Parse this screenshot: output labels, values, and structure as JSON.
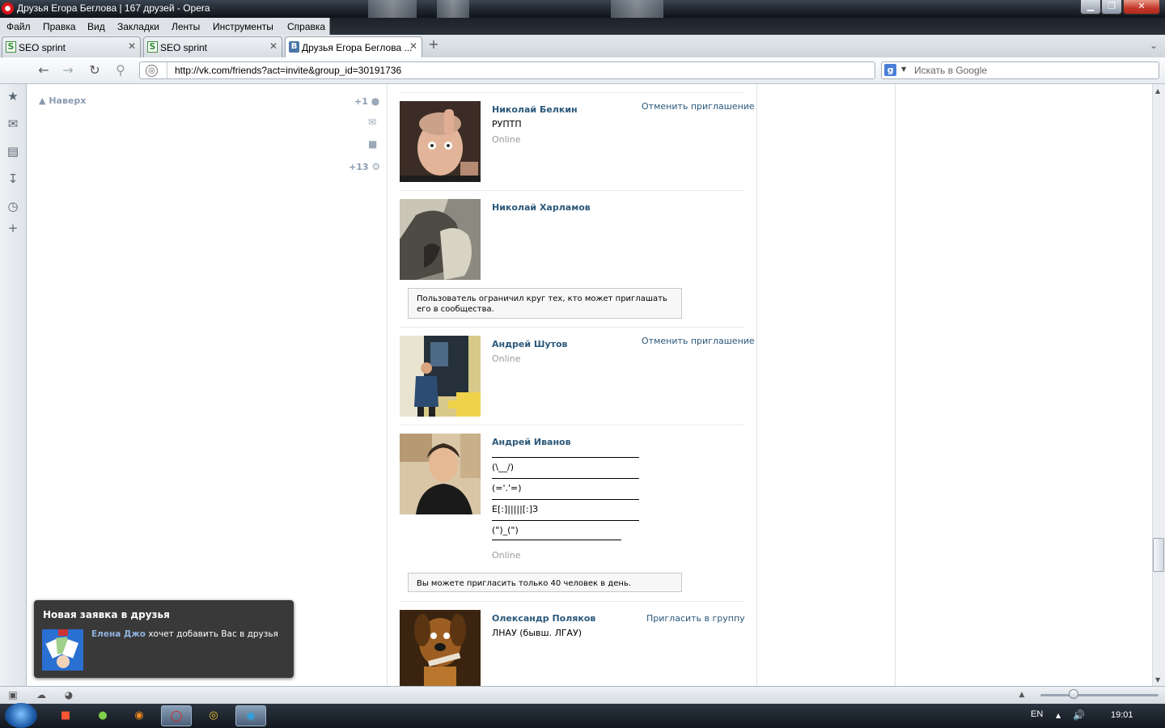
{
  "window": {
    "title": "Друзья Егора Беглова | 167 друзей - Opera",
    "min_label": "▁",
    "max_label": "❐",
    "close_label": "✕"
  },
  "menu": {
    "items": [
      "Файл",
      "Правка",
      "Вид",
      "Закладки",
      "Ленты",
      "Инструменты",
      "Справка"
    ]
  },
  "tabs": [
    {
      "label": "SEO sprint",
      "favicon": "seo-sprint-icon",
      "close": "✕"
    },
    {
      "label": "SEO sprint",
      "favicon": "seo-sprint-icon",
      "close": "✕"
    },
    {
      "label": "Друзья Егора Беглова ...",
      "favicon": "vk-icon",
      "close": "✕"
    }
  ],
  "tab_favicon_letters": {
    "seo": "S",
    "vk": "В"
  },
  "newtab_label": "+",
  "tabmenu_label": "⌄",
  "nav": {
    "url": "http://vk.com/friends?act=invite&group_id=30191736",
    "search_placeholder": "Искать в Google",
    "search_engine_letter": "g"
  },
  "left_column": {
    "up_label": "Наверх",
    "counter_friends": "+1",
    "counter_settings": "+13"
  },
  "friends": [
    {
      "name": "Николай Белкин",
      "status": "РУПТП",
      "online": "Online",
      "action": "Отменить приглашение"
    },
    {
      "name": "Николай Харламов",
      "notice": "Пользователь ограничил круг тех, кто может приглашать его в сообщества."
    },
    {
      "name": "Андрей Шутов",
      "online": "Online",
      "action": "Отменить приглашение"
    },
    {
      "name": "Андрей Иванов",
      "status_lines": [
        "(\\__/)",
        "(='.'=)",
        "E[:]|||||[:]З",
        "(\")_(\")"
      ],
      "online": "Online",
      "notice": "Вы можете пригласить только 40 человек в день."
    },
    {
      "name": "Олександр Поляков",
      "status": "ЛНАУ (бывш. ЛГАУ)",
      "action": "Пригласить в группу"
    }
  ],
  "notification": {
    "title": "Новая заявка в друзья",
    "name": "Елена Джо",
    "text": " хочет добавить Вас в друзья"
  },
  "taskbar": {
    "lang": "EN",
    "clock": "19:01"
  },
  "colors": {
    "vk_link": "#2b587a",
    "online_gray": "#999999",
    "popup_bg": "#393939"
  }
}
